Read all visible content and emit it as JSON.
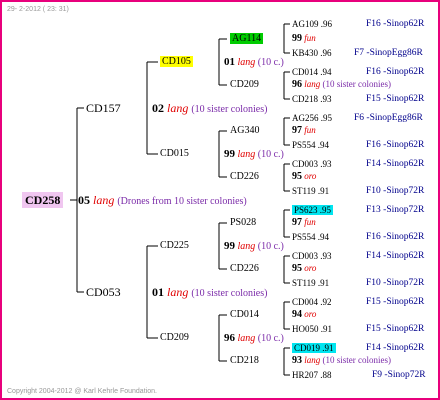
{
  "header": "29- 2-2012 ( 23: 31)",
  "footer": "Copyright 2004-2012 @ Karl Kehrle Foundation.",
  "root": {
    "name": "CD258",
    "pe": "05",
    "lang": "lang",
    "note": "(Drones from 10 sister colonies)"
  },
  "gen1": [
    {
      "name": "CD157",
      "pe": "02",
      "lang": "lang",
      "note": "(10 sister colonies)"
    },
    {
      "name": "CD053",
      "pe": "01",
      "lang": "lang",
      "note": "(10 sister colonies)"
    }
  ],
  "gen2": [
    {
      "name": "CD105",
      "pe": "01",
      "lang": "lang",
      "note": "(10 c.)"
    },
    {
      "name": "CD015",
      "pe": "99",
      "lang": "lang",
      "note": "(10 c.)"
    },
    {
      "name": "CD225",
      "pe": "99",
      "lang": "lang",
      "note": "(10 c.)"
    },
    {
      "name": "CD209",
      "pe": "96",
      "lang": "lang",
      "note": "(10 c.)"
    }
  ],
  "gen3": [
    {
      "name": "AG114",
      "pe": "99",
      "lang": "fun"
    },
    {
      "name": "CD209",
      "pe": "96",
      "lang": "lang",
      "note": "(10 sister colonies)"
    },
    {
      "name": "AG340",
      "pe": "97",
      "lang": "fun"
    },
    {
      "name": "CD226",
      "pe": "95",
      "lang": "oro"
    },
    {
      "name": "PS028",
      "pe": "97",
      "lang": "fun"
    },
    {
      "name": "CD226",
      "pe": "95",
      "lang": "oro"
    },
    {
      "name": "CD014",
      "pe": "94",
      "lang": "oro"
    },
    {
      "name": "CD218",
      "pe": "93",
      "lang": "lang",
      "note": "(10 sister colonies)"
    }
  ],
  "gen4": [
    {
      "name": "AG109",
      "score": ".96",
      "origin": "F16 -Sinop62R"
    },
    {
      "name": "KB430",
      "score": ".96",
      "origin": "F7 -SinopEgg86R"
    },
    {
      "name": "CD014",
      "score": ".94",
      "origin": "F16 -Sinop62R"
    },
    {
      "name": "CD218",
      "score": ".93",
      "origin": "F15 -Sinop62R"
    },
    {
      "name": "AG256",
      "score": ".95",
      "origin": "F6 -SinopEgg86R"
    },
    {
      "name": "PS554",
      "score": ".94",
      "origin": "F16 -Sinop62R"
    },
    {
      "name": "CD003",
      "score": ".93",
      "origin": "F14 -Sinop62R"
    },
    {
      "name": "ST119",
      "score": ".91",
      "origin": "F10 -Sinop72R"
    },
    {
      "name": "PS623",
      "score": ".95",
      "origin": "F13 -Sinop72R"
    },
    {
      "name": "PS554",
      "score": ".94",
      "origin": "F16 -Sinop62R"
    },
    {
      "name": "CD003",
      "score": ".93",
      "origin": "F14 -Sinop62R"
    },
    {
      "name": "ST119",
      "score": ".91",
      "origin": "F10 -Sinop72R"
    },
    {
      "name": "CD004",
      "score": ".92",
      "origin": "F15 -Sinop62R"
    },
    {
      "name": "HO050",
      "score": ".91",
      "origin": "F15 -Sinop62R"
    },
    {
      "name": "CD019",
      "score": ".91",
      "origin": "F14 -Sinop62R"
    },
    {
      "name": "HR207",
      "score": ".88",
      "origin": "F9 -Sinop72R"
    }
  ]
}
